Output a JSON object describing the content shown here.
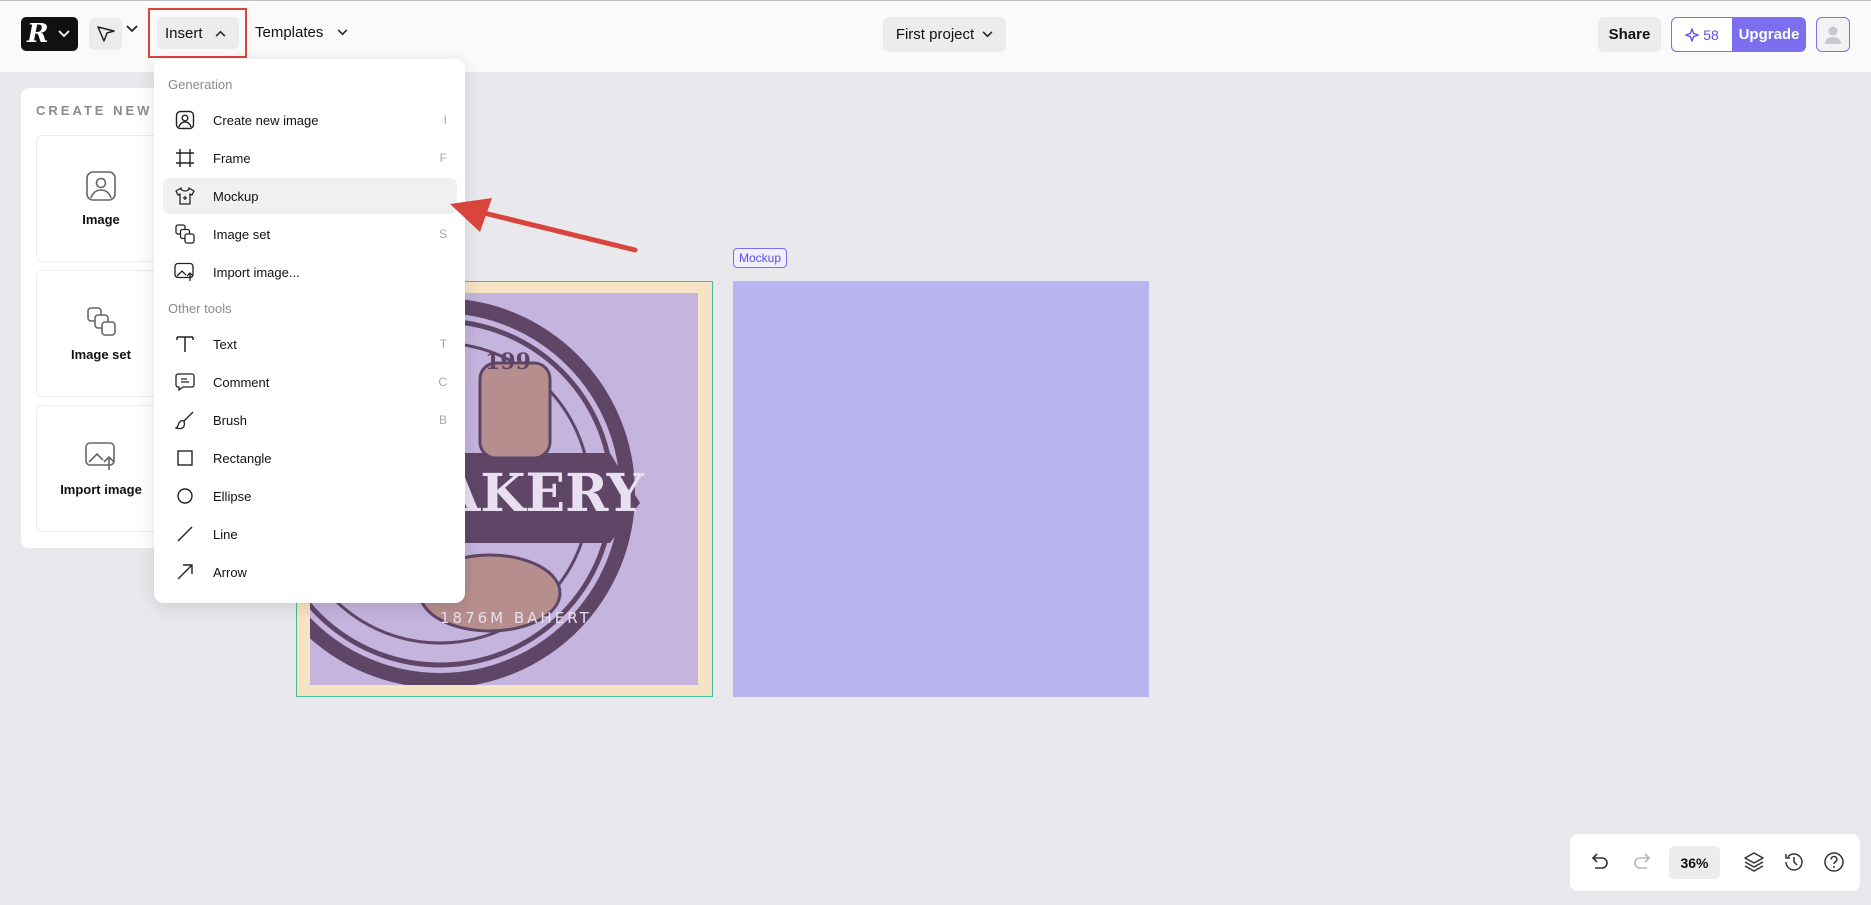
{
  "topbar": {
    "logo_mark": "R",
    "insert_label": "Insert",
    "templates_label": "Templates",
    "project_label": "First project",
    "share_label": "Share",
    "credits_count": "58",
    "upgrade_label": "Upgrade"
  },
  "panel": {
    "title": "CREATE NEW",
    "cards": [
      {
        "label": "Image",
        "icon": "image-icon"
      },
      {
        "label": "Image set",
        "icon": "image-set-icon"
      },
      {
        "label": "Import image",
        "icon": "import-image-icon"
      }
    ]
  },
  "canvas": {
    "mockup_tag": "Mockup",
    "logo_text_number": "199",
    "logo_text_main": "AKERY",
    "logo_text_bottom": "1876M BAHERT"
  },
  "menu": {
    "section_generation": "Generation",
    "section_other": "Other tools",
    "generation_items": [
      {
        "label": "Create new image",
        "key": "I",
        "icon": "image-icon"
      },
      {
        "label": "Frame",
        "key": "F",
        "icon": "frame-icon"
      },
      {
        "label": "Mockup",
        "key": "",
        "icon": "shirt-icon"
      },
      {
        "label": "Image set",
        "key": "S",
        "icon": "image-set-icon"
      },
      {
        "label": "Import image...",
        "key": "",
        "icon": "import-image-icon"
      }
    ],
    "other_items": [
      {
        "label": "Text",
        "key": "T",
        "icon": "text-icon"
      },
      {
        "label": "Comment",
        "key": "C",
        "icon": "comment-icon"
      },
      {
        "label": "Brush",
        "key": "B",
        "icon": "brush-icon"
      },
      {
        "label": "Rectangle",
        "key": "",
        "icon": "rectangle-icon"
      },
      {
        "label": "Ellipse",
        "key": "",
        "icon": "ellipse-icon"
      },
      {
        "label": "Line",
        "key": "",
        "icon": "line-icon"
      },
      {
        "label": "Arrow",
        "key": "",
        "icon": "arrow-icon"
      }
    ]
  },
  "bottom_bar": {
    "zoom": "36%"
  },
  "colors": {
    "accent": "#7b6ff0",
    "highlight_box": "#d9453c",
    "mockup_fill": "#b9b5ef",
    "frame_border": "#3fbf9c"
  }
}
